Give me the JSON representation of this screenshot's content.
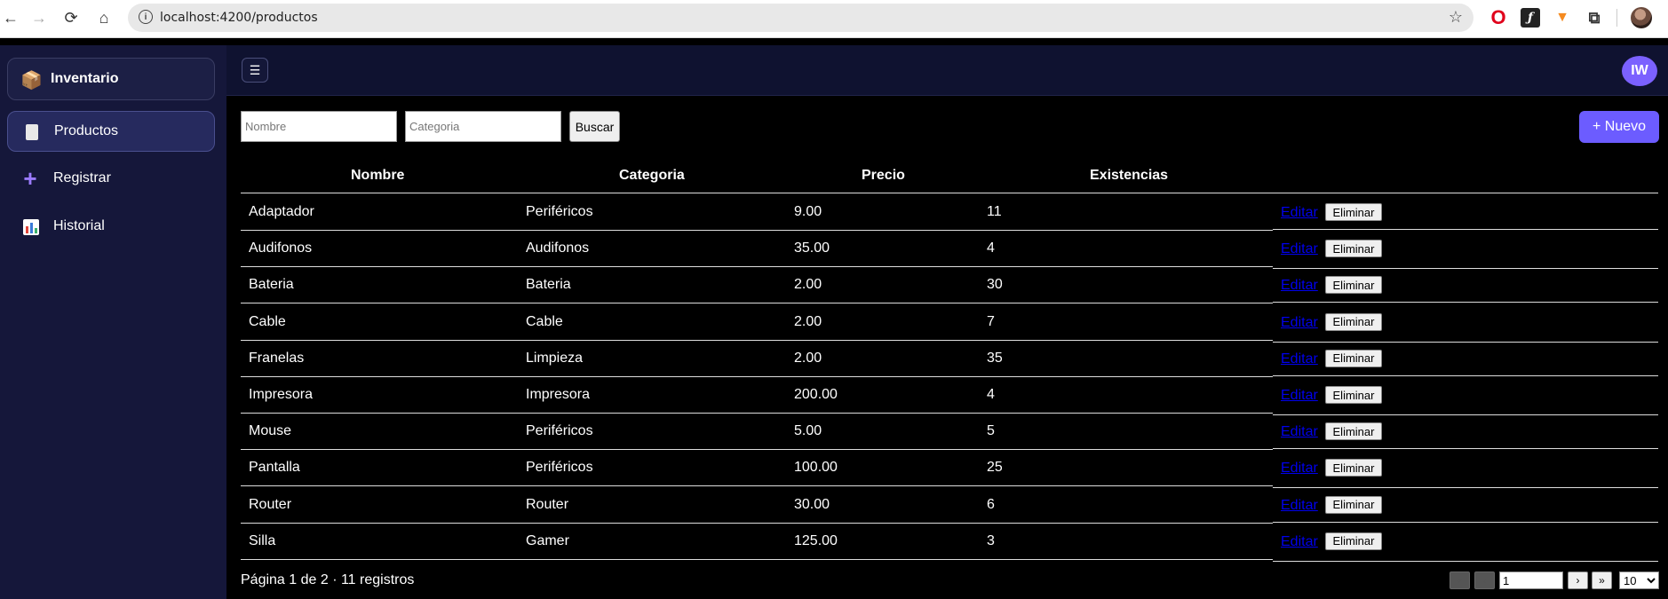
{
  "browser": {
    "url": "localhost:4200/productos"
  },
  "sidebar": {
    "brand": "Inventario",
    "items": [
      {
        "label": "Productos",
        "icon": "document-icon",
        "active": true
      },
      {
        "label": "Registrar",
        "icon": "plus-icon",
        "active": false
      },
      {
        "label": "Historial",
        "icon": "bar-chart-icon",
        "active": false
      }
    ]
  },
  "topbar": {
    "menu_glyph": "☰",
    "avatar_initials": "IW"
  },
  "filters": {
    "nombre_placeholder": "Nombre",
    "categoria_placeholder": "Categoria",
    "buscar_label": "Buscar",
    "nuevo_label": "+ Nuevo"
  },
  "table": {
    "columns": [
      "Nombre",
      "Categoria",
      "Precio",
      "Existencias"
    ],
    "edit_label": "Editar",
    "delete_label": "Eliminar",
    "rows": [
      {
        "nombre": "Adaptador",
        "categoria": "Periféricos",
        "precio": "9.00",
        "existencias": "11"
      },
      {
        "nombre": "Audifonos",
        "categoria": "Audifonos",
        "precio": "35.00",
        "existencias": "4"
      },
      {
        "nombre": "Bateria",
        "categoria": "Bateria",
        "precio": "2.00",
        "existencias": "30"
      },
      {
        "nombre": "Cable",
        "categoria": "Cable",
        "precio": "2.00",
        "existencias": "7"
      },
      {
        "nombre": "Franelas",
        "categoria": "Limpieza",
        "precio": "2.00",
        "existencias": "35"
      },
      {
        "nombre": "Impresora",
        "categoria": "Impresora",
        "precio": "200.00",
        "existencias": "4"
      },
      {
        "nombre": "Mouse",
        "categoria": "Periféricos",
        "precio": "5.00",
        "existencias": "5"
      },
      {
        "nombre": "Pantalla",
        "categoria": "Periféricos",
        "precio": "100.00",
        "existencias": "25"
      },
      {
        "nombre": "Router",
        "categoria": "Router",
        "precio": "30.00",
        "existencias": "6"
      },
      {
        "nombre": "Silla",
        "categoria": "Gamer",
        "precio": "125.00",
        "existencias": "3"
      }
    ]
  },
  "pagination": {
    "summary": "Página 1 de 2 · 11 registros",
    "first_label": "«",
    "prev_label": "‹",
    "next_label": "›",
    "last_label": "»",
    "page_value": "1",
    "page_size": "10"
  }
}
